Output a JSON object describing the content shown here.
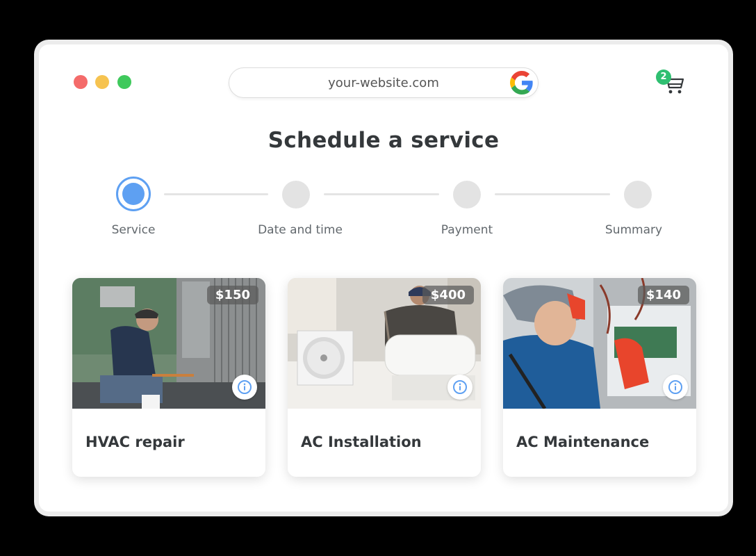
{
  "browser": {
    "url": "your-website.com",
    "cart_count": "2"
  },
  "page": {
    "title": "Schedule a service"
  },
  "steps": [
    {
      "label": "Service",
      "state": "active"
    },
    {
      "label": "Date and time",
      "state": "inactive"
    },
    {
      "label": "Payment",
      "state": "inactive"
    },
    {
      "label": "Summary",
      "state": "inactive"
    }
  ],
  "services": [
    {
      "name": "HVAC repair",
      "price": "$150"
    },
    {
      "name": "AC Installation",
      "price": "$400"
    },
    {
      "name": "AC Maintenance",
      "price": "$140"
    }
  ],
  "colors": {
    "accent": "#5ea0f2",
    "badge": "#2fbf71",
    "title_text": "#34383b"
  }
}
